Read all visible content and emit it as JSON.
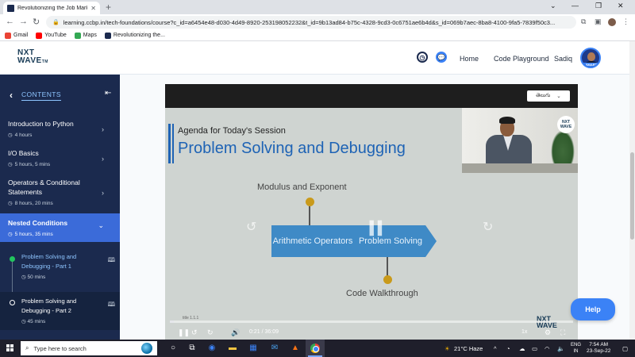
{
  "browser": {
    "tab_title": "Revolutionizing the Job Mark",
    "url": "learning.ccbp.in/tech-foundations/course?c_id=a6454e48-d030-4d49-8920-253198052232&t_id=9b13ad84-b75c-4328-9cd3-0c6751ae6b4d&s_id=069b7aec-8ba8-4100-9fa5-7839f50c3...",
    "bookmarks": [
      {
        "label": "Gmail",
        "color": "#ea4335"
      },
      {
        "label": "YouTube",
        "color": "#ff0000"
      },
      {
        "label": "Maps",
        "color": "#34a853"
      },
      {
        "label": "Revolutionizing the...",
        "color": "#1b2a4e"
      }
    ]
  },
  "header": {
    "logo_line1": "NXT",
    "logo_line2": "WAVE",
    "logo_tm": "TM",
    "home": "Home",
    "code_playground": "Code Playground",
    "user_name": "Sadiq",
    "avatar_badge": "SMART"
  },
  "sidebar": {
    "title": "CONTENTS",
    "modules": [
      {
        "name": "Introduction to Python",
        "duration": "4 hours"
      },
      {
        "name": "I/O Basics",
        "duration": "5 hours, 5 mins"
      },
      {
        "name": "Operators & Conditional Statements",
        "duration": "8 hours, 20 mins"
      },
      {
        "name": "Nested Conditions",
        "duration": "5 hours, 35 mins"
      }
    ],
    "sessions": [
      {
        "name": "Problem Solving and Debugging - Part 1",
        "duration": "50 mins"
      },
      {
        "name": "Problem Solving and Debugging - Part 2",
        "duration": "45 mins"
      }
    ]
  },
  "video": {
    "language": "తెలుగు",
    "slide_subtitle": "Agenda for Today's Session",
    "slide_title": "Problem Solving and Debugging",
    "node_top": "Modulus and Exponent",
    "arrow1": "Arithmetic Operators",
    "arrow2": "Problem Solving",
    "node_bottom": "Code Walkthrough",
    "cam_logo": "NXT WAVE",
    "watermark1": "NXT",
    "watermark2": "WAVE",
    "thumb_title": "title 1.1.1",
    "current_time": "0:21",
    "total_time": "36:09",
    "time_sep": " / ",
    "speed": "1x",
    "progress": 0.01
  },
  "help_button": "Help",
  "taskbar": {
    "search_placeholder": "Type here to search",
    "weather": "21°C  Haze",
    "lang1": "ENG",
    "lang2": "IN",
    "time": "7:54 AM",
    "date": "23-Sep-22"
  }
}
